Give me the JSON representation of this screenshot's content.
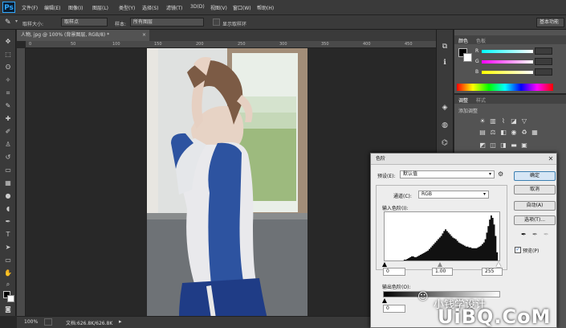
{
  "app": {
    "logo": "Ps"
  },
  "menu": [
    "文件(F)",
    "编辑(E)",
    "图像(I)",
    "图层(L)",
    "类型(Y)",
    "选择(S)",
    "滤镜(T)",
    "3D(D)",
    "视图(V)",
    "窗口(W)",
    "帮助(H)"
  ],
  "options": {
    "sample_size_label": "取样大小:",
    "sample_size_value": "取样点",
    "sample_label": "样本:",
    "sample_value": "所有图层",
    "show_ring_label": "显示取样环",
    "workspace": "基本功能"
  },
  "document": {
    "tab": "人物, jpg @ 100% (背景图层, RGB/8) *",
    "close": "×"
  },
  "ruler_h": [
    "0",
    "50",
    "100",
    "150",
    "200",
    "250",
    "300",
    "350",
    "400",
    "450"
  ],
  "status": {
    "zoom": "100%",
    "doc_info": "文档:626.8K/626.8K",
    "arrow": "▸"
  },
  "color_panel": {
    "tabs": [
      "颜色",
      "色板"
    ],
    "channels": [
      "R",
      "G",
      "B"
    ]
  },
  "adjust_panel": {
    "tabs": [
      "调整",
      "样式"
    ],
    "title": "添加调整"
  },
  "levels": {
    "title": "色阶",
    "close": "✕",
    "preset_label": "预设(E):",
    "preset_value": "默认值",
    "channel_label": "通道(C):",
    "channel_value": "RGB",
    "input_label": "输入色阶(I):",
    "input_values": [
      "0",
      "1.00",
      "255"
    ],
    "output_label": "输出色阶(O):",
    "output_values": [
      "0"
    ],
    "buttons": {
      "ok": "确定",
      "cancel": "取消",
      "auto": "自动(A)",
      "options": "选项(T)..."
    },
    "preview_label": "预览(P)",
    "histogram": [
      0,
      0,
      0,
      0,
      0,
      0,
      0,
      0,
      0,
      0,
      0,
      0,
      0,
      1,
      1,
      2,
      3,
      4,
      5,
      5,
      4,
      4,
      5,
      6,
      7,
      8,
      9,
      10,
      11,
      12,
      14,
      16,
      18,
      20,
      22,
      24,
      26,
      28,
      30,
      33,
      36,
      38,
      36,
      34,
      32,
      30,
      28,
      27,
      26,
      24,
      22,
      21,
      20,
      19,
      18,
      17,
      17,
      16,
      16,
      15,
      15,
      15,
      15,
      16,
      17,
      18,
      20,
      22,
      26,
      34,
      42,
      50,
      55,
      52,
      44,
      30,
      10,
      0
    ]
  },
  "watermark": {
    "cn": "小钱学设计",
    "site": "UiBQ.CoM"
  }
}
